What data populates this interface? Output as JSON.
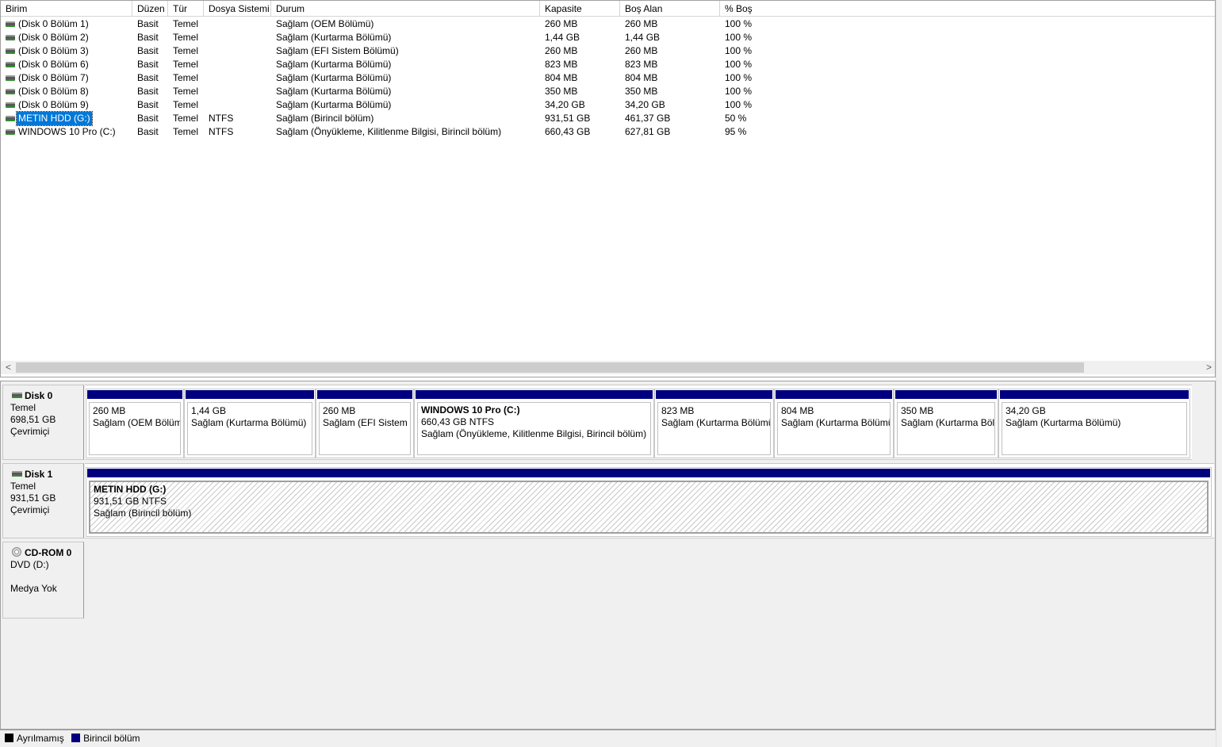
{
  "columns": [
    "Birim",
    "Düzen",
    "Tür",
    "Dosya Sistemi",
    "Durum",
    "Kapasite",
    "Boş Alan",
    "% Boş"
  ],
  "volumes": [
    {
      "name": "(Disk 0 Bölüm 1)",
      "layout": "Basit",
      "type": "Temel",
      "fs": "",
      "status": "Sağlam (OEM Bölümü)",
      "capacity": "260 MB",
      "free": "260 MB",
      "pct": "100 %"
    },
    {
      "name": "(Disk 0 Bölüm 2)",
      "layout": "Basit",
      "type": "Temel",
      "fs": "",
      "status": "Sağlam (Kurtarma Bölümü)",
      "capacity": "1,44 GB",
      "free": "1,44 GB",
      "pct": "100 %"
    },
    {
      "name": "(Disk 0 Bölüm 3)",
      "layout": "Basit",
      "type": "Temel",
      "fs": "",
      "status": "Sağlam (EFI Sistem Bölümü)",
      "capacity": "260 MB",
      "free": "260 MB",
      "pct": "100 %"
    },
    {
      "name": "(Disk 0 Bölüm 6)",
      "layout": "Basit",
      "type": "Temel",
      "fs": "",
      "status": "Sağlam (Kurtarma Bölümü)",
      "capacity": "823 MB",
      "free": "823 MB",
      "pct": "100 %"
    },
    {
      "name": "(Disk 0 Bölüm 7)",
      "layout": "Basit",
      "type": "Temel",
      "fs": "",
      "status": "Sağlam (Kurtarma Bölümü)",
      "capacity": "804 MB",
      "free": "804 MB",
      "pct": "100 %"
    },
    {
      "name": "(Disk 0 Bölüm 8)",
      "layout": "Basit",
      "type": "Temel",
      "fs": "",
      "status": "Sağlam (Kurtarma Bölümü)",
      "capacity": "350 MB",
      "free": "350 MB",
      "pct": "100 %"
    },
    {
      "name": "(Disk 0 Bölüm 9)",
      "layout": "Basit",
      "type": "Temel",
      "fs": "",
      "status": "Sağlam (Kurtarma Bölümü)",
      "capacity": "34,20 GB",
      "free": "34,20 GB",
      "pct": "100 %"
    },
    {
      "name": "METIN HDD (G:)",
      "layout": "Basit",
      "type": "Temel",
      "fs": "NTFS",
      "status": "Sağlam (Birincil bölüm)",
      "capacity": "931,51 GB",
      "free": "461,37 GB",
      "pct": "50 %"
    },
    {
      "name": "WINDOWS 10 Pro (C:)",
      "layout": "Basit",
      "type": "Temel",
      "fs": "NTFS",
      "status": "Sağlam (Önyükleme, Kilitlenme Bilgisi, Birincil bölüm)",
      "capacity": "660,43 GB",
      "free": "627,81 GB",
      "pct": "95 %"
    }
  ],
  "scroll": {
    "left": "<",
    "right": ">"
  },
  "disks": [
    {
      "title": "Disk 0",
      "type": "Temel",
      "size": "698,51 GB",
      "state": "Çevrimiçi",
      "partitions": [
        {
          "name": "",
          "line1": "260 MB",
          "line2": "Sağlam (OEM Bölümü)"
        },
        {
          "name": "",
          "line1": "1,44 GB",
          "line2": "Sağlam (Kurtarma Bölümü)"
        },
        {
          "name": "",
          "line1": "260 MB",
          "line2": "Sağlam (EFI Sistem Bölümü)"
        },
        {
          "name": "WINDOWS 10 Pro  (C:)",
          "line1": "660,43 GB NTFS",
          "line2": "Sağlam (Önyükleme, Kilitlenme Bilgisi, Birincil bölüm)"
        },
        {
          "name": "",
          "line1": "823 MB",
          "line2": "Sağlam (Kurtarma Bölümü)"
        },
        {
          "name": "",
          "line1": "804 MB",
          "line2": "Sağlam (Kurtarma Bölümü)"
        },
        {
          "name": "",
          "line1": "350 MB",
          "line2": "Sağlam (Kurtarma Bölümü)"
        },
        {
          "name": "",
          "line1": "34,20 GB",
          "line2": "Sağlam (Kurtarma Bölümü)"
        }
      ]
    },
    {
      "title": "Disk 1",
      "type": "Temel",
      "size": "931,51 GB",
      "state": "Çevrimiçi",
      "partitions": [
        {
          "name": "METIN HDD  (G:)",
          "line1": "931,51 GB NTFS",
          "line2": "Sağlam (Birincil bölüm)"
        }
      ]
    },
    {
      "title": "CD-ROM 0",
      "type": "DVD (D:)",
      "size": "",
      "state": "Medya Yok"
    }
  ],
  "legend": [
    {
      "label": "Ayrılmamış",
      "color": "#000000"
    },
    {
      "label": "Birincil bölüm",
      "color": "#00007f"
    }
  ],
  "colors": {
    "partition_bar": "#00007f",
    "selection": "#0078d7"
  }
}
